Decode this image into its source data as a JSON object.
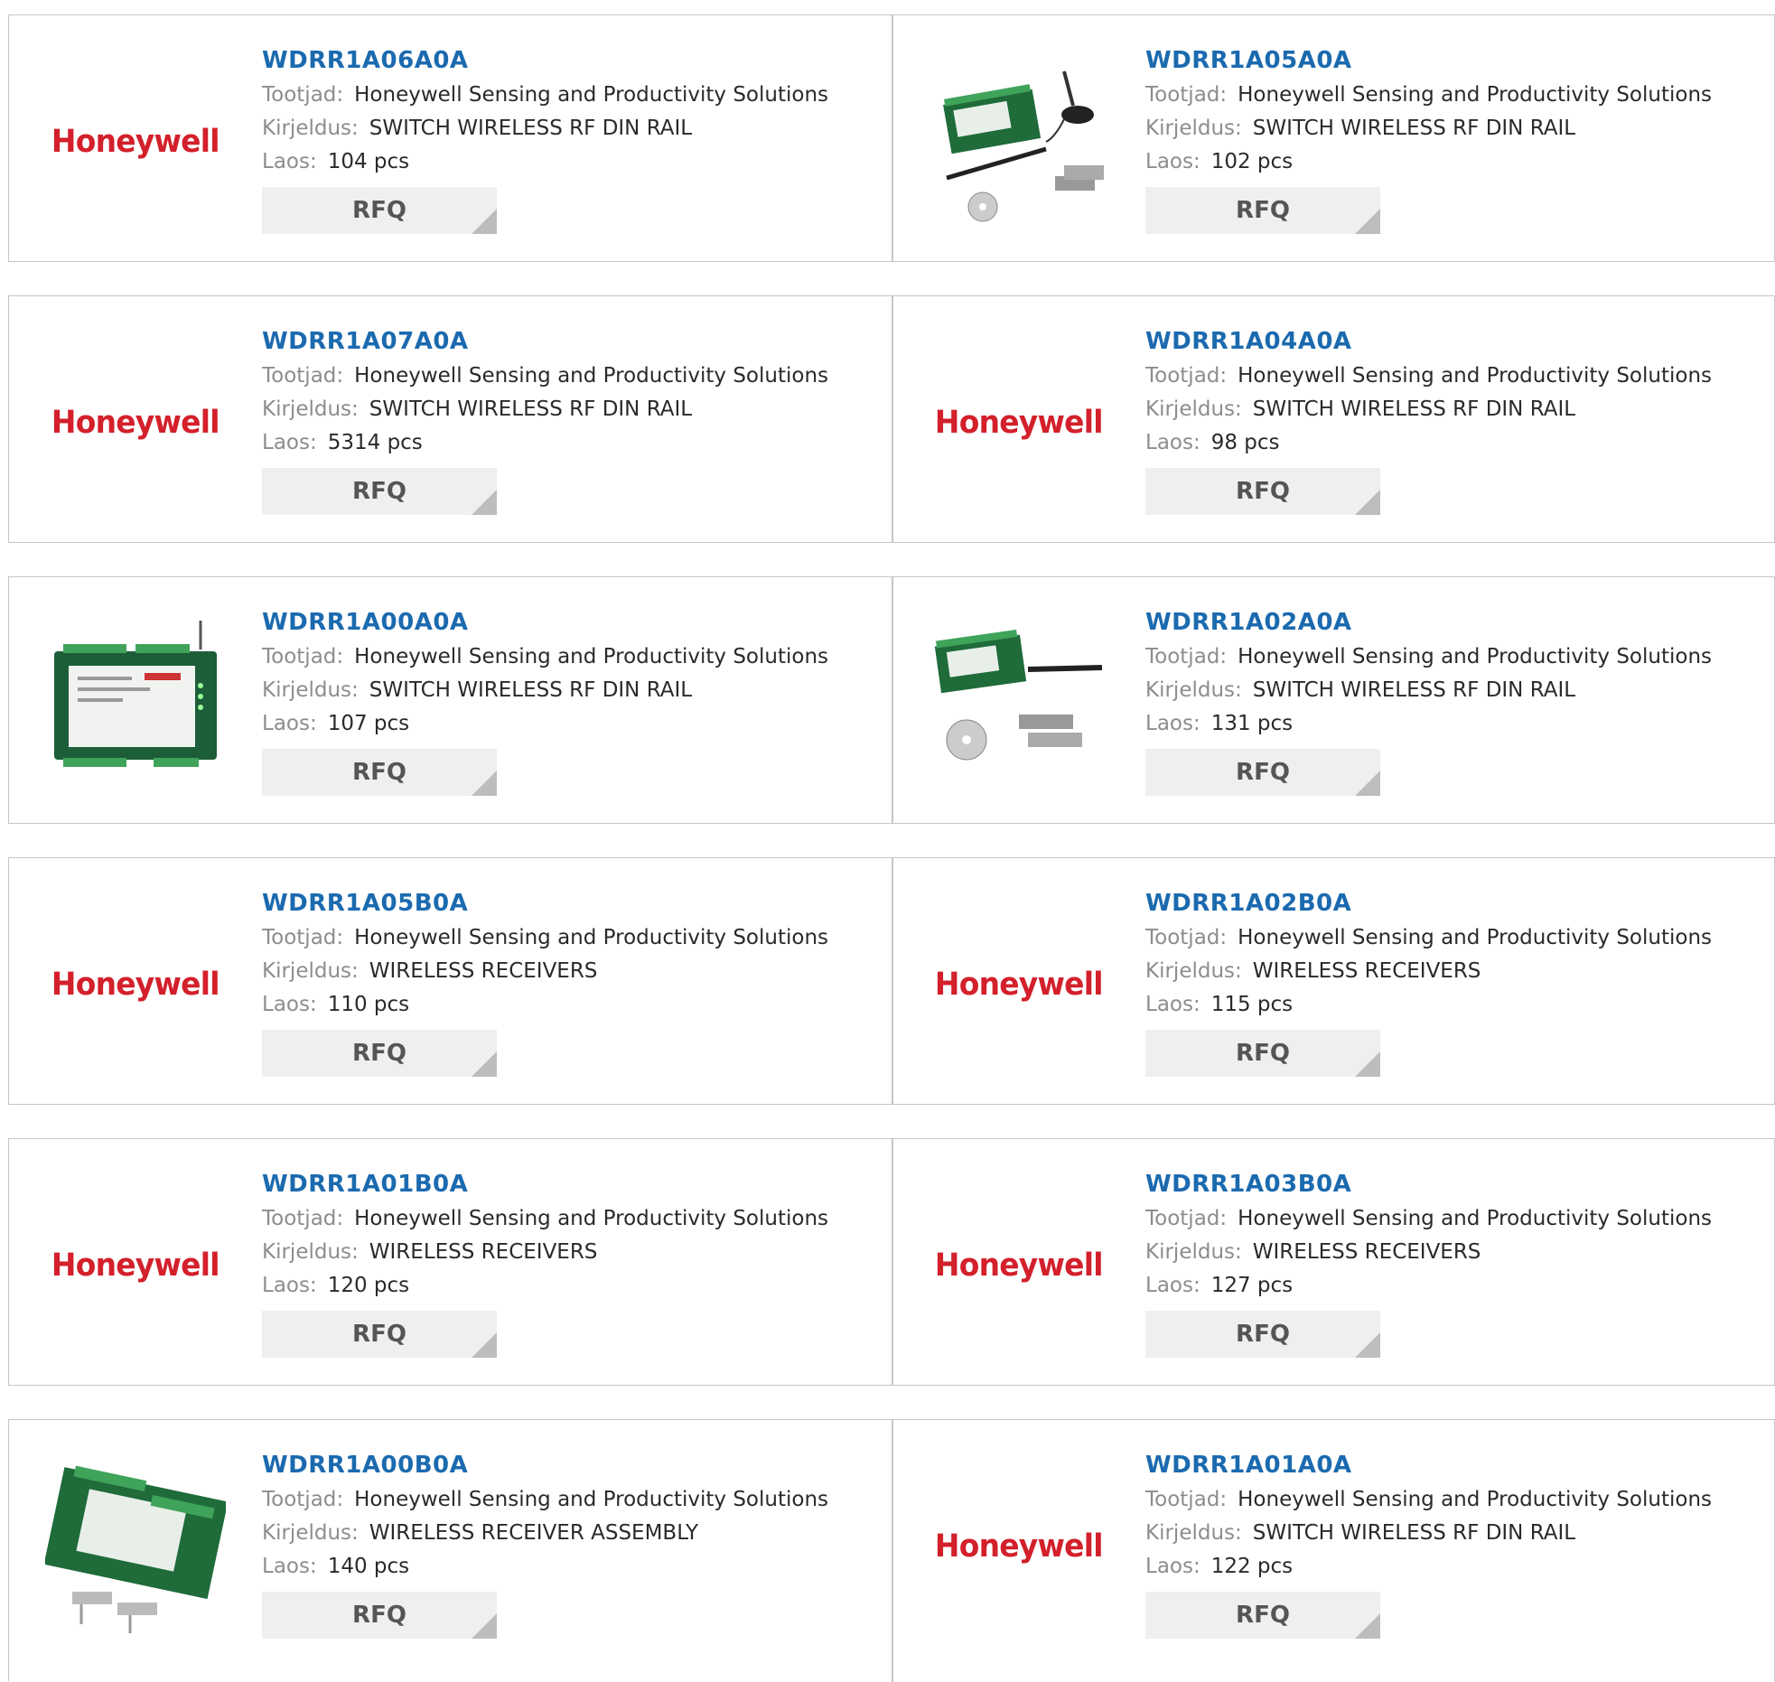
{
  "labels": {
    "manufacturer": "Tootjad:",
    "description": "Kirjeldus:",
    "stock": "Laos:",
    "rfq": "RFQ",
    "logo_text": "Honeywell"
  },
  "colors": {
    "part_link": "#1b6aaf",
    "brand_red": "#d3202b",
    "label_grey": "#8d8d8d",
    "rfq_bg": "#efefef"
  },
  "products": [
    {
      "part": "WDRR1A06A0A",
      "manufacturer": "Honeywell Sensing and Productivity Solutions",
      "description": "SWITCH WIRELESS RF DIN RAIL",
      "stock": "104 pcs",
      "image": "honeywell-logo"
    },
    {
      "part": "WDRR1A05A0A",
      "manufacturer": "Honeywell Sensing and Productivity Solutions",
      "description": "SWITCH WIRELESS RF DIN RAIL",
      "stock": "102 pcs",
      "image": "receiver-kit-magnetic-antenna"
    },
    {
      "part": "WDRR1A07A0A",
      "manufacturer": "Honeywell Sensing and Productivity Solutions",
      "description": "SWITCH WIRELESS RF DIN RAIL",
      "stock": "5314 pcs",
      "image": "honeywell-logo"
    },
    {
      "part": "WDRR1A04A0A",
      "manufacturer": "Honeywell Sensing and Productivity Solutions",
      "description": "SWITCH WIRELESS RF DIN RAIL",
      "stock": "98 pcs",
      "image": "honeywell-logo"
    },
    {
      "part": "WDRR1A00A0A",
      "manufacturer": "Honeywell Sensing and Productivity Solutions",
      "description": "SWITCH WIRELESS RF DIN RAIL",
      "stock": "107 pcs",
      "image": "receiver-module"
    },
    {
      "part": "WDRR1A02A0A",
      "manufacturer": "Honeywell Sensing and Productivity Solutions",
      "description": "SWITCH WIRELESS RF DIN RAIL",
      "stock": "131 pcs",
      "image": "receiver-kit-antenna"
    },
    {
      "part": "WDRR1A05B0A",
      "manufacturer": "Honeywell Sensing and Productivity Solutions",
      "description": "WIRELESS RECEIVERS",
      "stock": "110 pcs",
      "image": "honeywell-logo"
    },
    {
      "part": "WDRR1A02B0A",
      "manufacturer": "Honeywell Sensing and Productivity Solutions",
      "description": "WIRELESS RECEIVERS",
      "stock": "115 pcs",
      "image": "honeywell-logo"
    },
    {
      "part": "WDRR1A01B0A",
      "manufacturer": "Honeywell Sensing and Productivity Solutions",
      "description": "WIRELESS RECEIVERS",
      "stock": "120 pcs",
      "image": "honeywell-logo"
    },
    {
      "part": "WDRR1A03B0A",
      "manufacturer": "Honeywell Sensing and Productivity Solutions",
      "description": "WIRELESS RECEIVERS",
      "stock": "127 pcs",
      "image": "honeywell-logo"
    },
    {
      "part": "WDRR1A00B0A",
      "manufacturer": "Honeywell Sensing and Productivity Solutions",
      "description": "WIRELESS RECEIVER ASSEMBLY",
      "stock": "140 pcs",
      "image": "receiver-assembly"
    },
    {
      "part": "WDRR1A01A0A",
      "manufacturer": "Honeywell Sensing and Productivity Solutions",
      "description": "SWITCH WIRELESS RF DIN RAIL",
      "stock": "122 pcs",
      "image": "honeywell-logo"
    }
  ]
}
